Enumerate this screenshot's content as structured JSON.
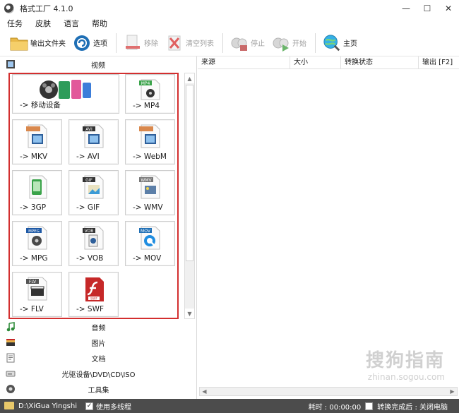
{
  "window": {
    "title": "格式工厂 4.1.0",
    "controls": [
      "—",
      "☐",
      "✕"
    ]
  },
  "menu": [
    "任务",
    "皮肤",
    "语言",
    "帮助"
  ],
  "toolbar": {
    "output_folder": "输出文件夹",
    "options": "选项",
    "remove": "移除",
    "clear_list": "清空列表",
    "stop": "停止",
    "start": "开始",
    "home": "主页"
  },
  "categories": {
    "video": "视频",
    "audio": "音频",
    "picture": "图片",
    "document": "文档",
    "rom": "光驱设备\\DVD\\CD\\ISO",
    "tools": "工具集"
  },
  "formats": {
    "mobile": "-> 移动设备",
    "mp4": "-> MP4",
    "mkv": "-> MKV",
    "avi": "-> AVI",
    "webm": "-> WebM",
    "gp3": "-> 3GP",
    "gif": "-> GIF",
    "wmv": "-> WMV",
    "mpg": "-> MPG",
    "vob": "-> VOB",
    "mov": "-> MOV",
    "flv": "-> FLV",
    "swf": "-> SWF"
  },
  "format_badges": {
    "mp4": "MP4",
    "avi": "AVI",
    "gif": "GIF",
    "wmv": "WMV",
    "mpeg": "MPEG",
    "vob": "VOB",
    "mov": "MOV",
    "flv": "FLV",
    "swf": "SWF"
  },
  "table": {
    "columns": [
      "来源",
      "大小",
      "转换状态",
      "输出 [F2]"
    ]
  },
  "watermark": {
    "main": "搜狗指南",
    "sub": "zhinan.sogou.com"
  },
  "status": {
    "output_path": "D:\\XiGua Yingshi",
    "multithread_label": "使用多线程",
    "multithread_checked": true,
    "elapsed": "耗时 : 00:00:00",
    "after_done": "转换完成后 : 关闭电脑",
    "after_done_checked": false
  },
  "colors": {
    "highlight_border": "#d32f2f",
    "statusbar_bg": "#4c4c4c"
  }
}
